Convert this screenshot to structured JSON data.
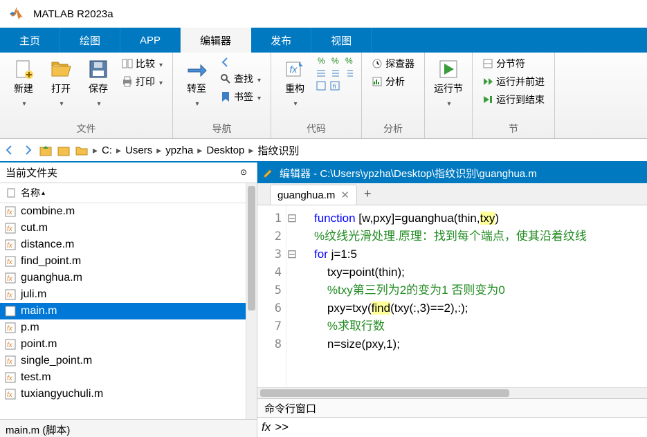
{
  "title": "MATLAB R2023a",
  "tabs": [
    "主页",
    "绘图",
    "APP",
    "编辑器",
    "发布",
    "视图"
  ],
  "selected_tab": 3,
  "toolstrip": {
    "groups": {
      "file": {
        "label": "文件",
        "new": "新建",
        "open": "打开",
        "save": "保存",
        "compare": "比较",
        "print": "打印"
      },
      "nav": {
        "label": "导航",
        "goto": "转至",
        "find": "查找",
        "bookmark": "书签"
      },
      "code": {
        "label": "代码",
        "refactor": "重构"
      },
      "analyze": {
        "label": "分析",
        "explorer": "探查器",
        "analyze": "分析"
      },
      "run": {
        "label": "运行节",
        "btn": "运行节"
      },
      "section": {
        "label": "节",
        "split": "分节符",
        "advance": "运行并前进",
        "toend": "运行到结束"
      }
    }
  },
  "path": [
    "C:",
    "Users",
    "ypzha",
    "Desktop",
    "指纹识别"
  ],
  "left_panel": {
    "title": "当前文件夹",
    "header": "名称"
  },
  "files": [
    "combine.m",
    "cut.m",
    "distance.m",
    "find_point.m",
    "guanghua.m",
    "juli.m",
    "main.m",
    "p.m",
    "point.m",
    "single_point.m",
    "test.m",
    "tuxiangyuchuli.m"
  ],
  "selected_file_index": 6,
  "status": "main.m (脚本)",
  "editor": {
    "title": "编辑器 - C:\\Users\\ypzha\\Desktop\\指纹识别\\guanghua.m",
    "tab": "guanghua.m",
    "lines": [
      1,
      2,
      3,
      4,
      5,
      6,
      7,
      8
    ],
    "fold": [
      "⊟",
      "",
      "⊟",
      "",
      "",
      "",
      "",
      ""
    ],
    "code": {
      "l1a": "function",
      "l1b": " [w,pxy]=guanghua(thin,",
      "l1c": "txy",
      "l1d": ")",
      "l2": "%纹线光滑处理.原理：找到每个端点，使其沿着纹线",
      "l3a": "for",
      "l3b": " j=1:5",
      "l4": "    txy=point(thin);",
      "l5": "    %txy第三列为2的变为1 否则变为0",
      "l6a": "    pxy=txy(",
      "l6b": "find",
      "l6c": "(txy(:,3)==2),:);",
      "l7": "    %求取行数",
      "l8": "    n=size(pxy,1);"
    }
  },
  "cmd": {
    "title": "命令行窗口",
    "prompt": ">>"
  }
}
